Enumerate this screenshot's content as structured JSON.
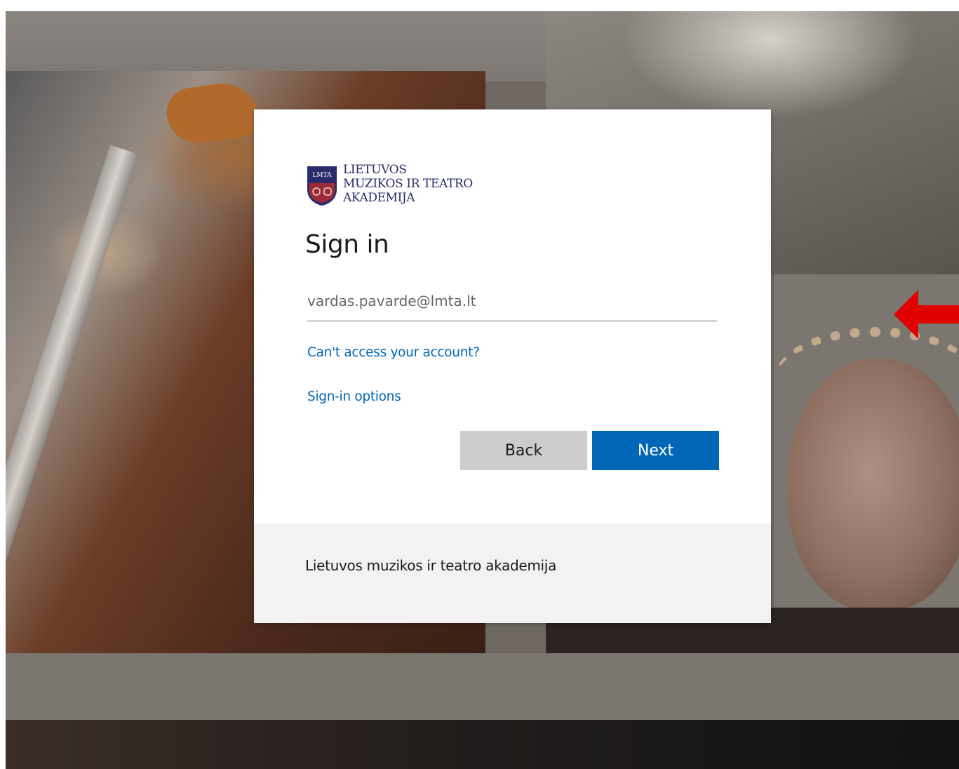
{
  "organization": {
    "logo_abbreviation": "LMTA",
    "logo_lines": [
      "LIETUVOS",
      "MUZIKOS IR TEATRO",
      "AKADEMIJA"
    ],
    "footer_text": "Lietuvos muzikos ir teatro akademija"
  },
  "signin": {
    "title": "Sign in",
    "email_placeholder": "vardas.pavarde@lmta.lt",
    "email_value": "",
    "cant_access_link": "Can't access your account?",
    "options_link": "Sign-in options",
    "back_label": "Back",
    "next_label": "Next"
  },
  "colors": {
    "accent": "#0067b8",
    "back_button": "#cccccc",
    "footer_background": "#f2f2f2",
    "annotation_arrow": "#e00000"
  },
  "icons": {
    "annotation": "red-arrow-left-icon",
    "logo": "lmta-shield-icon"
  }
}
